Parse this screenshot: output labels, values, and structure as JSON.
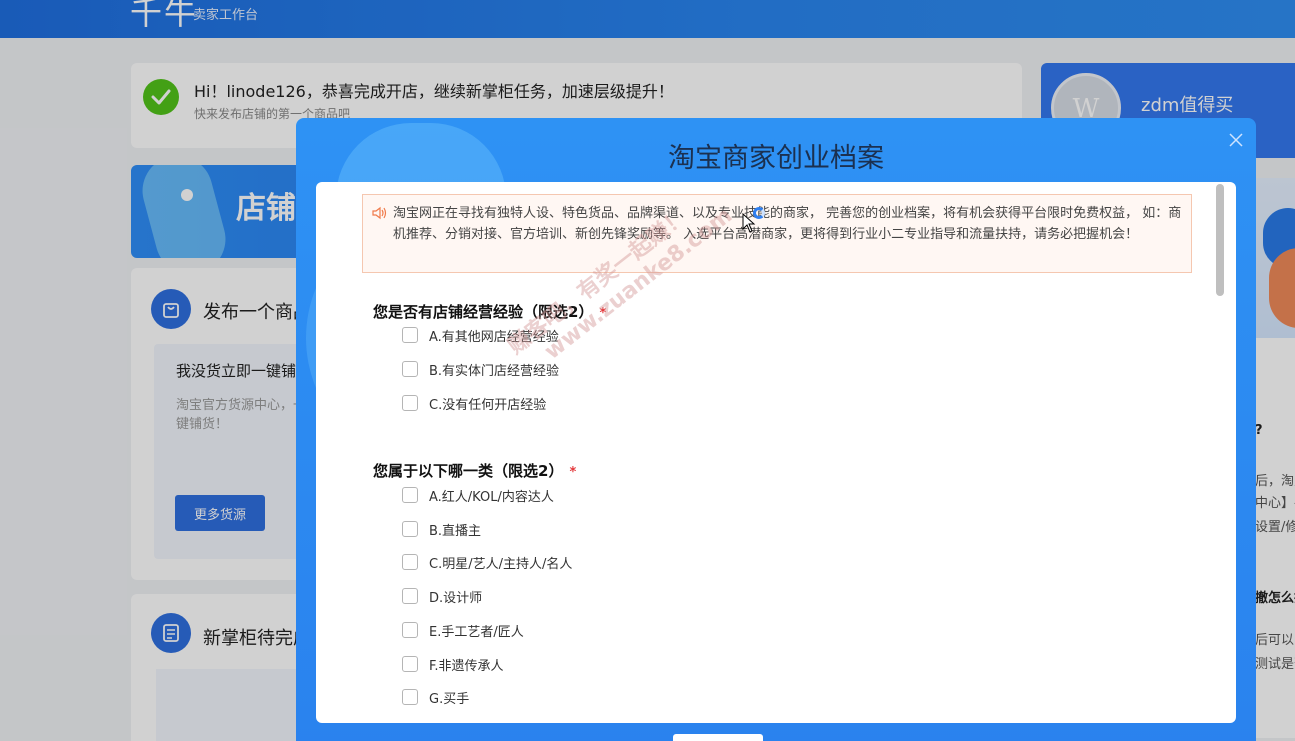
{
  "header": {
    "logo": "千牛",
    "subtitle": "卖家工作台"
  },
  "welcome": {
    "title": "Hi！linode126，恭喜完成开店，继续新掌柜任务，加速层级提升！",
    "subtitle": "快来发布店铺的第一个商品吧"
  },
  "banner": {
    "text": "店铺"
  },
  "publish": {
    "title": "发布一个商品",
    "inner_title": "我没货立即一键铺",
    "inner_desc": "淘宝官方货源中心，一键铺货！",
    "button": "更多货源"
  },
  "todo": {
    "title": "新掌柜待完成"
  },
  "user": {
    "name": "zdm值得买",
    "avatar_letter": "W"
  },
  "right_text": {
    "line1": "?",
    "line2": "后，淘宝",
    "line3": "中心】-",
    "line4": "设置/修",
    "line5": "撤怎么找",
    "line6": "后可以申",
    "line7": "测试是否"
  },
  "modal": {
    "title": "淘宝商家创业档案",
    "notice": "淘宝网正在寻找有独特人设、特色货品、品牌渠道、以及专业技能的商家， 完善您的创业档案，将有机会获得平台限时免费权益， 如：商机推荐、分销对接、官方培训、新创先锋奖励等。 入选平台高潜商家，更将得到行业小二专业指导和流量扶持，请务必把握机会！",
    "questions": [
      {
        "title": "您是否有店铺经营经验（限选2）",
        "required_mark": "*",
        "options": [
          "A.有其他网店经营经验",
          "B.有实体门店经营经验",
          "C.没有任何开店经验"
        ]
      },
      {
        "title": "您属于以下哪一类（限选2）",
        "required_mark": "*",
        "options": [
          "A.红人/KOL/内容达人",
          "B.直播主",
          "C.明星/艺人/主持人/名人",
          "D.设计师",
          "E.手工艺者/匠人",
          "F.非遗传承人",
          "G.买手"
        ]
      }
    ]
  },
  "watermark": {
    "line1": "赚客吧，有奖一起赚！",
    "line2": "www.zuanke8.com"
  },
  "colors": {
    "header_blue": "#1f6fe0",
    "primary": "#2f6fe0",
    "modal_blue": "#2e92f4",
    "required_red": "#e4393c",
    "success_green": "#52c41a"
  }
}
